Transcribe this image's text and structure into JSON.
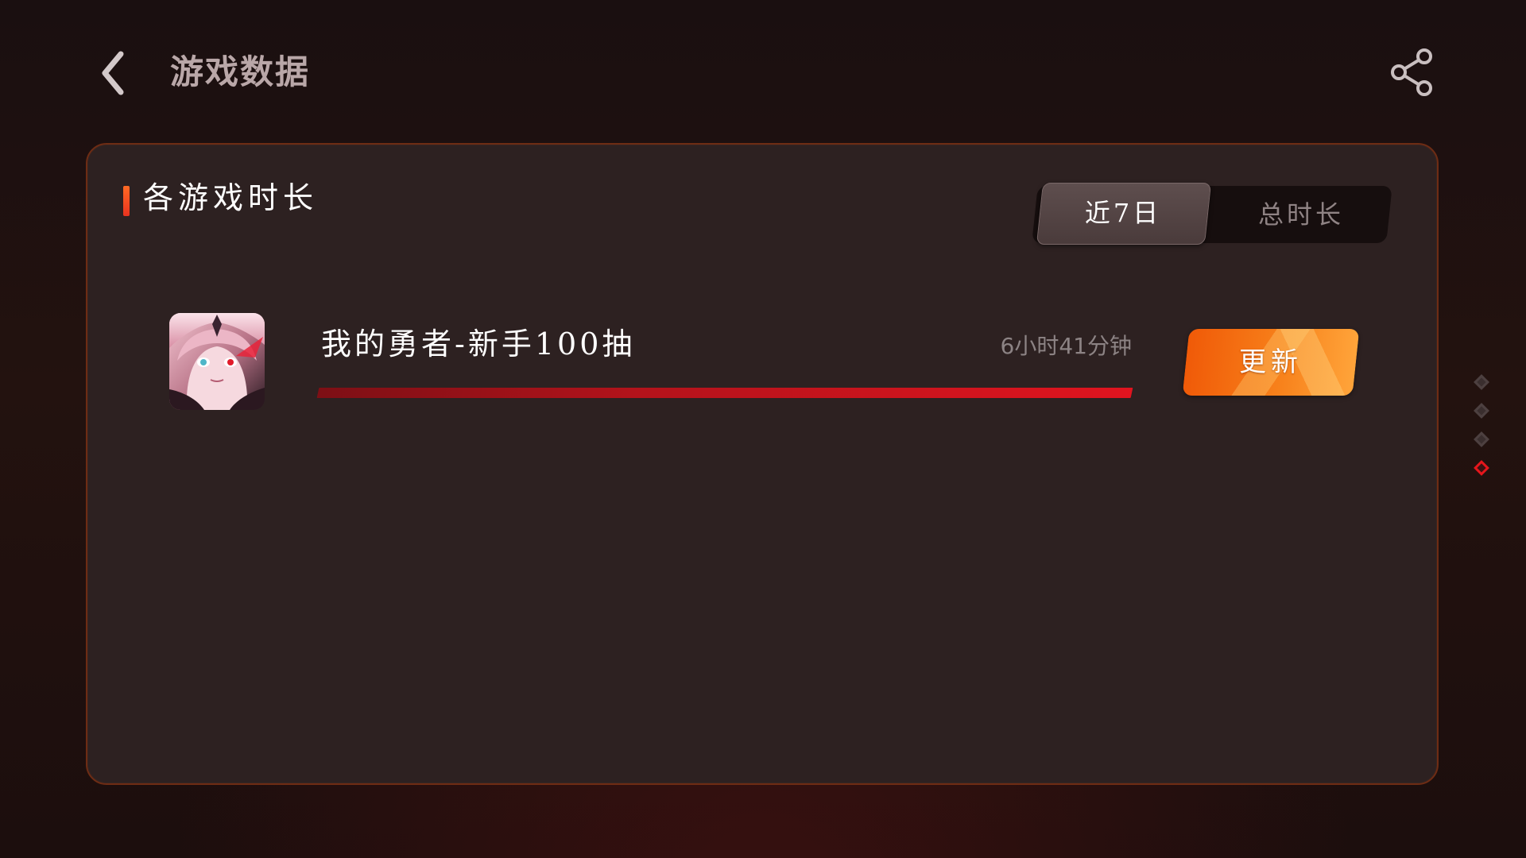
{
  "header": {
    "back_icon": "chevron-left-icon",
    "title": "游戏数据",
    "share_icon": "share-icon"
  },
  "card": {
    "section_title": "各游戏时长",
    "toggle": {
      "options": [
        "近7日",
        "总时长"
      ],
      "selected": "近7日"
    },
    "games": [
      {
        "name": "我的勇者-新手100抽",
        "duration": "6小时41分钟",
        "progress": 1.0,
        "action_label": "更新",
        "icon": "game-avatar-icon"
      }
    ]
  },
  "pagination": {
    "count": 4,
    "active_index": 3
  },
  "colors": {
    "accent_red": "#e0141f",
    "accent_orange": "#f7801a",
    "card_border": "#6e2c14",
    "card_bg": "#2d2121"
  }
}
